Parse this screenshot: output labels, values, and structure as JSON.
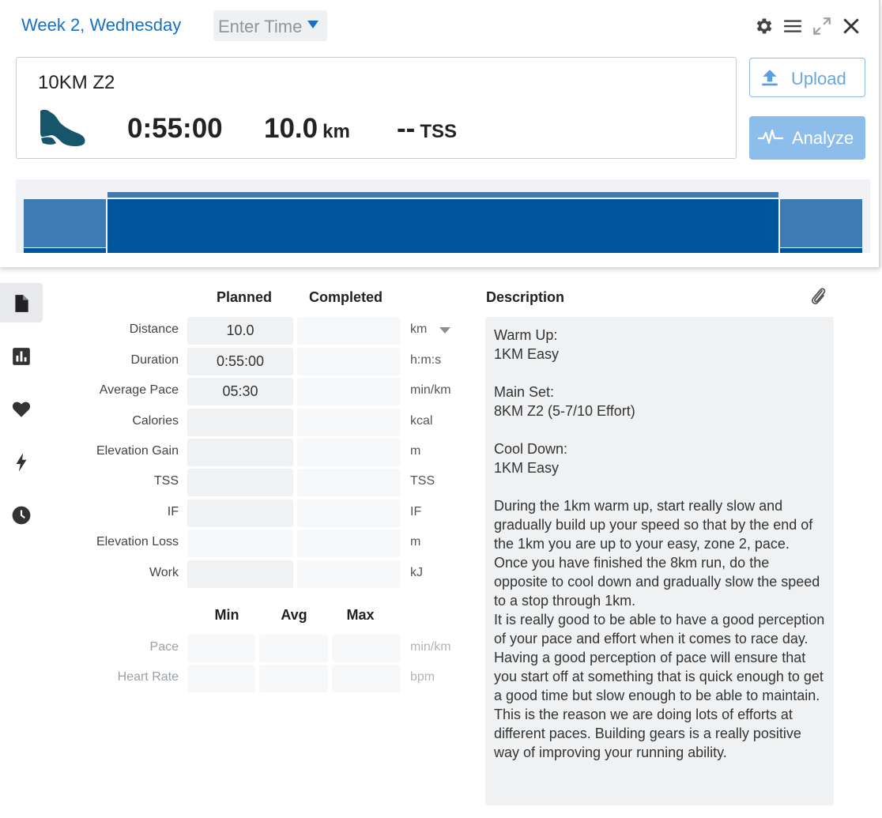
{
  "header": {
    "week_day": "Week 2, Wednesday",
    "time_placeholder": "Enter Time"
  },
  "toolbar": {
    "icons": [
      "gear-icon",
      "menu-icon",
      "expand-icon",
      "close-icon"
    ]
  },
  "workout": {
    "title": "10KM Z2",
    "duration": "0:55:00",
    "distance_value": "10.0",
    "distance_unit": "km",
    "tss_value": "--",
    "tss_unit": "TSS",
    "sport_icon": "running-shoe-icon"
  },
  "buttons": {
    "upload": "Upload",
    "analyze": "Analyze"
  },
  "colors": {
    "accent": "#1a6fc2",
    "profile_main": "#00569c",
    "profile_light": "#3e7ab3",
    "analyze_bg": "#8cbdeb"
  },
  "side_nav": [
    {
      "icon": "document-icon",
      "active": true
    },
    {
      "icon": "bar-chart-icon",
      "active": false
    },
    {
      "icon": "heart-icon",
      "active": false
    },
    {
      "icon": "lightning-icon",
      "active": false
    },
    {
      "icon": "clock-icon",
      "active": false
    }
  ],
  "metrics": {
    "planned_header": "Planned",
    "completed_header": "Completed",
    "rows": [
      {
        "label": "Distance",
        "planned": "10.0",
        "completed": "",
        "unit": "km"
      },
      {
        "label": "Duration",
        "planned": "0:55:00",
        "completed": "",
        "unit": "h:m:s"
      },
      {
        "label": "Average Pace",
        "planned": "05:30",
        "completed": "",
        "unit": "min/km"
      },
      {
        "label": "Calories",
        "planned": "",
        "completed": "",
        "unit": "kcal"
      },
      {
        "label": "Elevation Gain",
        "planned": "",
        "completed": "",
        "unit": "m"
      },
      {
        "label": "TSS",
        "planned": "",
        "completed": "",
        "unit": "TSS"
      },
      {
        "label": "IF",
        "planned": "",
        "completed": "",
        "unit": "IF"
      },
      {
        "label": "Elevation Loss",
        "planned": "",
        "completed": "",
        "unit": "m"
      },
      {
        "label": "Work",
        "planned": "",
        "completed": "",
        "unit": "kJ"
      }
    ]
  },
  "range": {
    "min_header": "Min",
    "avg_header": "Avg",
    "max_header": "Max",
    "rows": [
      {
        "label": "Pace",
        "unit": "min/km"
      },
      {
        "label": "Heart Rate",
        "unit": "bpm"
      }
    ]
  },
  "description": {
    "header": "Description",
    "text": "Warm Up:\n1KM Easy\n\nMain Set:\n8KM Z2 (5-7/10 Effort)\n\nCool Down:\n1KM Easy\n\nDuring the 1km warm up, start really slow and gradually build up your speed so that by the end of the 1km you are up to your easy, zone 2, pace. Once you have finished the 8km run, do the opposite to cool down and gradually slow the speed to a stop through 1km.\nIt is really good to be able to have a good perception of your pace and effort when it comes to race day.\nHaving a good perception of pace will ensure that you start off at something that is quick enough to get a good time but slow enough to be able to maintain.\nThis is the reason we are doing lots of efforts at different paces. Building gears is a really positive way of improving your running ability."
  }
}
